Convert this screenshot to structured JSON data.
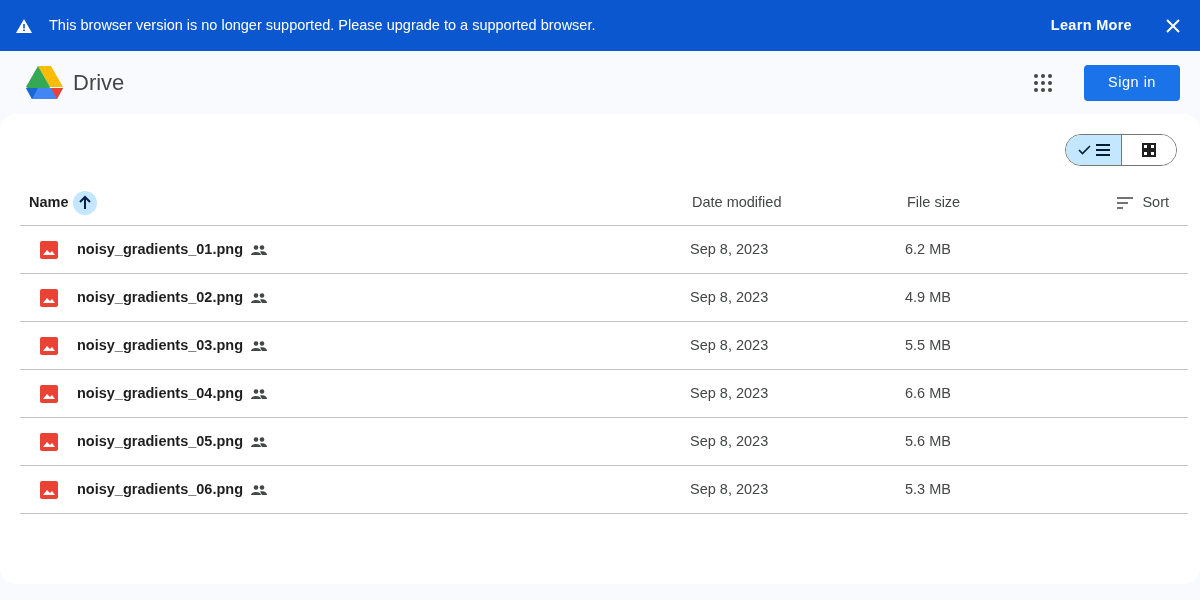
{
  "banner": {
    "message": "This browser version is no longer supported. Please upgrade to a supported browser.",
    "link": "Learn More"
  },
  "header": {
    "app_name": "Drive",
    "sign_in": "Sign in"
  },
  "view_toggle": [
    {
      "kind": "list",
      "selected": true
    },
    {
      "kind": "grid",
      "selected": false
    }
  ],
  "table": {
    "columns": [
      {
        "label": "Name",
        "sorted": true
      },
      {
        "label": "Date modified",
        "sorted": false
      },
      {
        "label": "File size",
        "sorted": false
      }
    ],
    "sort": "Sort",
    "rows": [
      {
        "name": "noisy_gradients_01.png",
        "shared": true,
        "date": "Sep 8, 2023",
        "size": "6.2 MB"
      },
      {
        "name": "noisy_gradients_02.png",
        "shared": true,
        "date": "Sep 8, 2023",
        "size": "4.9 MB"
      },
      {
        "name": "noisy_gradients_03.png",
        "shared": true,
        "date": "Sep 8, 2023",
        "size": "5.5 MB"
      },
      {
        "name": "noisy_gradients_04.png",
        "shared": true,
        "date": "Sep 8, 2023",
        "size": "6.6 MB"
      },
      {
        "name": "noisy_gradients_05.png",
        "shared": true,
        "date": "Sep 8, 2023",
        "size": "5.6 MB"
      },
      {
        "name": "noisy_gradients_06.png",
        "shared": true,
        "date": "Sep 8, 2023",
        "size": "5.3 MB"
      }
    ]
  }
}
